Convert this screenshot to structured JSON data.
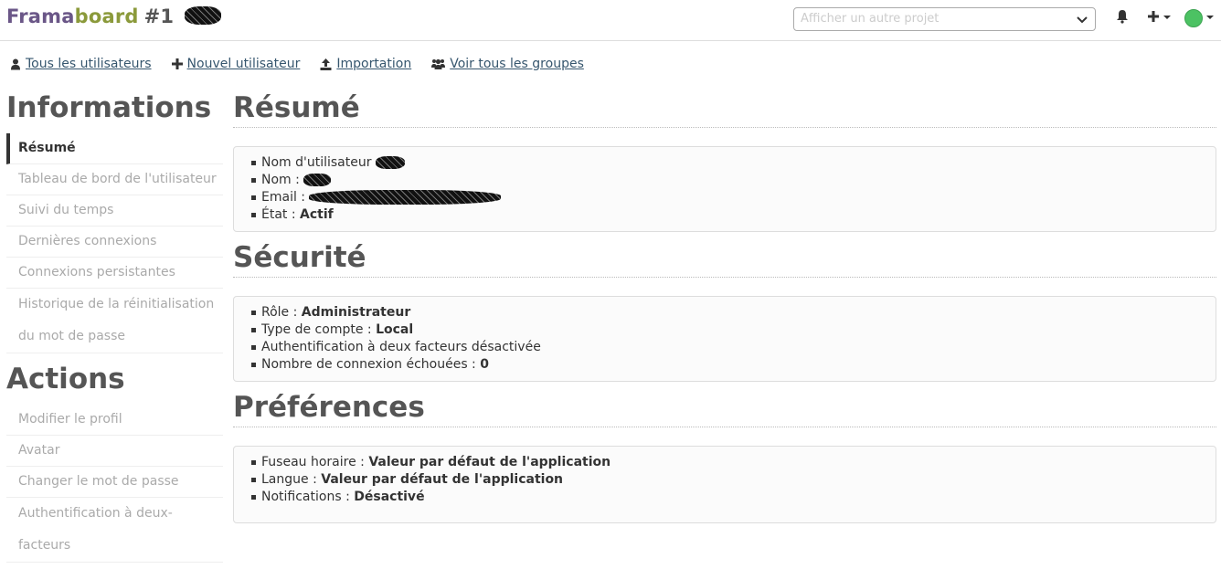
{
  "header": {
    "logo_part1": "Frama",
    "logo_part2": "board",
    "logo_num": "#1",
    "project_placeholder": "Afficher un autre projet"
  },
  "toolbar": {
    "all_users": "Tous les utilisateurs",
    "new_user": "Nouvel utilisateur",
    "import": "Importation",
    "all_groups": "Voir tous les groupes"
  },
  "sidebar": {
    "info_title": "Informations",
    "info_items": [
      "Résumé",
      "Tableau de bord de l'utilisateur",
      "Suivi du temps",
      "Dernières connexions",
      "Connexions persistantes",
      "Historique de la réinitialisation du mot de passe"
    ],
    "actions_title": "Actions",
    "action_items": [
      "Modifier le profil",
      "Avatar",
      "Changer le mot de passe",
      "Authentification à deux-facteurs"
    ]
  },
  "summary": {
    "title": "Résumé",
    "username_label": "Nom d'utilisateur",
    "name_label": "Nom :",
    "email_label": "Email :",
    "state_label": "État :",
    "state_value": "Actif"
  },
  "security": {
    "title": "Sécurité",
    "role_label": "Rôle :",
    "role_value": "Administrateur",
    "account_type_label": "Type de compte :",
    "account_type_value": "Local",
    "two_factor": "Authentification à deux facteurs désactivée",
    "failed_label": "Nombre de connexion échouées :",
    "failed_value": "0"
  },
  "preferences": {
    "title": "Préférences",
    "timezone_label": "Fuseau horaire :",
    "timezone_value": "Valeur par défaut de l'application",
    "language_label": "Langue :",
    "language_value": "Valeur par défaut de l'application",
    "notifications_label": "Notifications :",
    "notifications_value": "Désactivé"
  },
  "colors": {
    "frama": "#6a5687",
    "board": "#8b9a3b",
    "link": "#36566e",
    "avatar": "#4cc263"
  }
}
